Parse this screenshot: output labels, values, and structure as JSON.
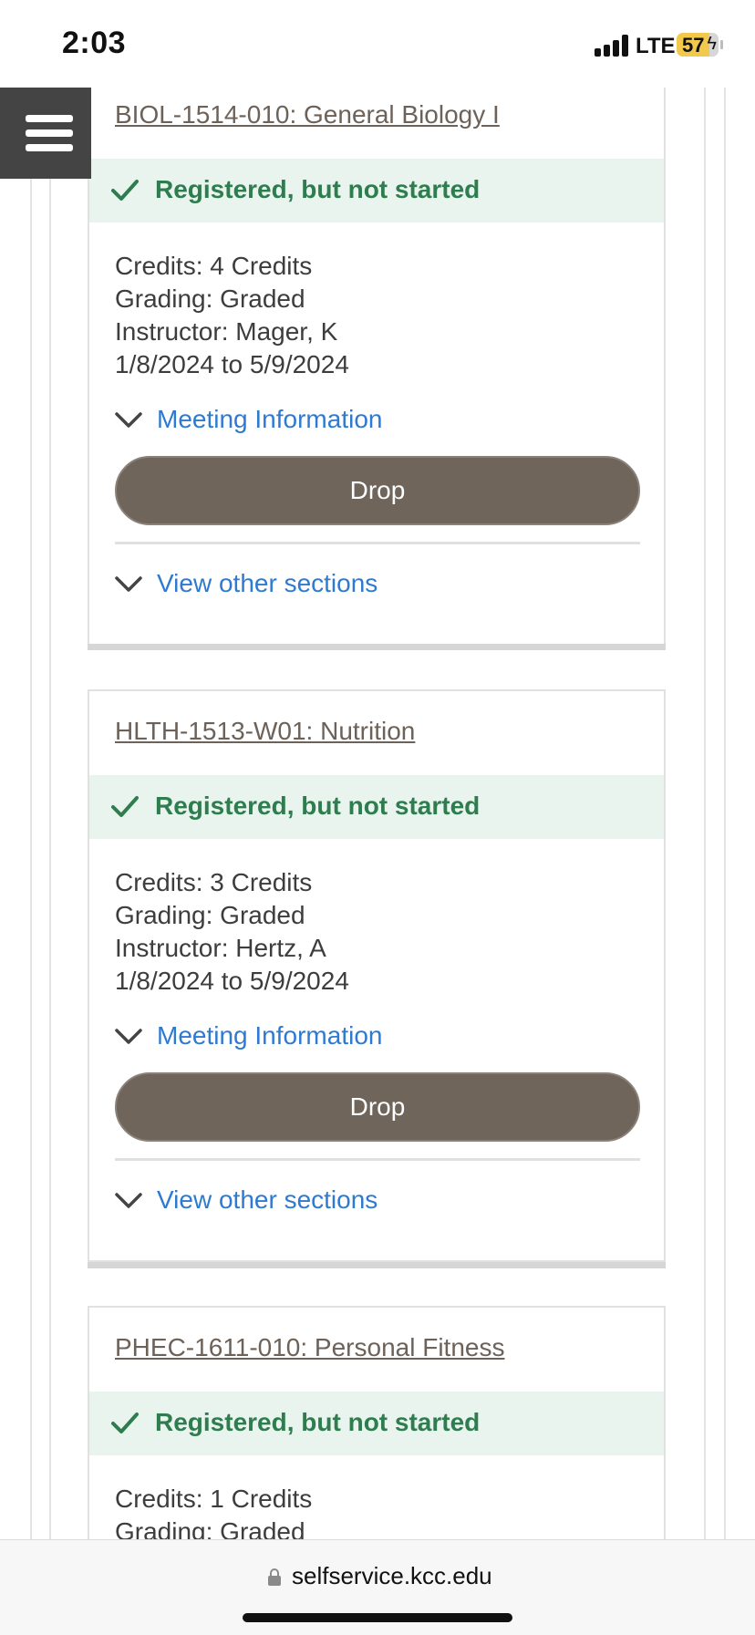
{
  "status_bar": {
    "time": "2:03",
    "network": "LTE",
    "battery": "57"
  },
  "courses": [
    {
      "title": "BIOL-1514-010: General Biology I",
      "status": "Registered, but not started",
      "credits": "Credits: 4 Credits",
      "grading": "Grading: Graded",
      "instructor": "Instructor: Mager, K",
      "dates": "1/8/2024 to 5/9/2024",
      "meeting_label": "Meeting Information",
      "drop_label": "Drop",
      "other_sections_label": "View other sections"
    },
    {
      "title": "HLTH-1513-W01: Nutrition",
      "status": "Registered, but not started",
      "credits": "Credits: 3 Credits",
      "grading": "Grading: Graded",
      "instructor": "Instructor: Hertz, A",
      "dates": "1/8/2024 to 5/9/2024",
      "meeting_label": "Meeting Information",
      "drop_label": "Drop",
      "other_sections_label": "View other sections"
    },
    {
      "title": "PHEC-1611-010: Personal Fitness",
      "status": "Registered, but not started",
      "credits": "Credits: 1 Credits",
      "grading": "Grading: Graded"
    }
  ],
  "browser": {
    "url": "selfservice.kcc.edu"
  },
  "colors": {
    "status_green": "#2e7d4f",
    "status_bg": "#eaf4ee",
    "link_blue": "#2e7ad1",
    "drop_button": "#6f655b",
    "title_brown": "#6d6259",
    "menu_bg": "#444444"
  },
  "icons": [
    "menu-icon",
    "check-icon",
    "chevron-down-icon",
    "lock-icon",
    "signal-icon",
    "battery-icon"
  ]
}
